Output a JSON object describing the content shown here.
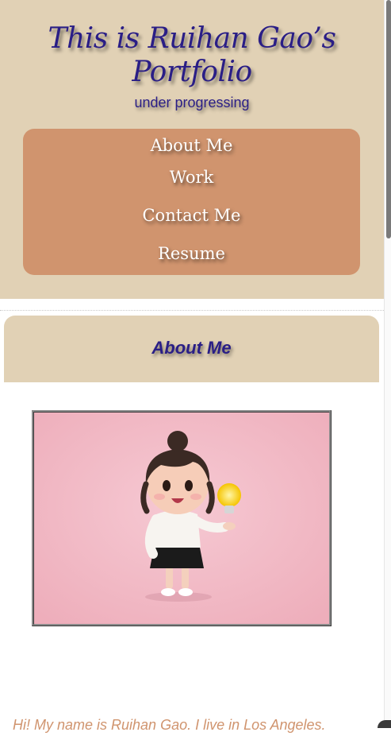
{
  "header": {
    "title_line1": "This is Ruihan Gao’s",
    "title_line2": "Portfolio",
    "subtitle": "under progressing"
  },
  "nav": {
    "items": [
      {
        "label": "About Me"
      },
      {
        "label": "Work"
      },
      {
        "label": "Contact Me"
      },
      {
        "label": "Resume"
      }
    ]
  },
  "about": {
    "heading": "About Me",
    "image_alt": "3D cartoon girl holding a lightbulb on pink background",
    "intro": "Hi! My name is Ruihan Gao. I live in Los Angeles."
  },
  "colors": {
    "header_bg": "#e1d1b5",
    "nav_bg": "#d0946e",
    "title": "#2a1e86",
    "intro_text": "#d0946e"
  }
}
